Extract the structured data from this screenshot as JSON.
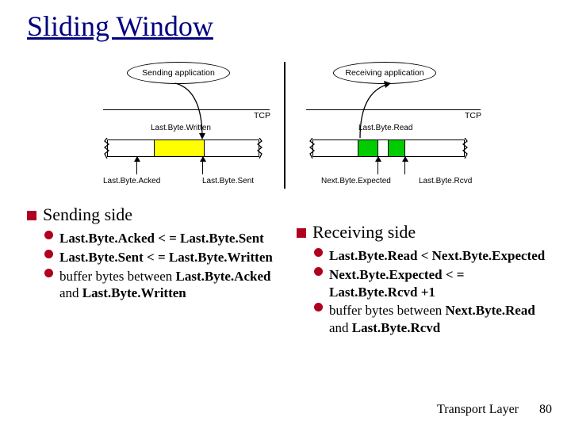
{
  "title": "Sliding Window",
  "diagram": {
    "sending_app": "Sending application",
    "receiving_app": "Receiving application",
    "tcp": "TCP",
    "last_byte_written": "Last.Byte.Written",
    "last_byte_read": "Last.Byte.Read",
    "last_byte_acked": "Last.Byte.Acked",
    "last_byte_sent": "Last.Byte.Sent",
    "next_byte_expected": "Next.Byte.Expected",
    "last_byte_rcvd": "Last.Byte.Rcvd"
  },
  "sending": {
    "heading": "Sending side",
    "b1": "Last.Byte.Acked < = Last.Byte.Sent",
    "b2": "Last.Byte.Sent < = Last.Byte.Written",
    "b3a": "buffer bytes between",
    "b3b": "Last.Byte.Acked",
    "b3c": " and ",
    "b3d": "Last.Byte.Written"
  },
  "receiving": {
    "heading": "Receiving side",
    "b1": "Last.Byte.Read < Next.Byte.Expected",
    "b2": "Next.Byte.Expected < = Last.Byte.Rcvd +1",
    "b3a": "buffer bytes between",
    "b3b": "Next.Byte.Read",
    "b3c": " and ",
    "b3d": "Last.Byte.Rcvd"
  },
  "footer": {
    "section": "Transport Layer",
    "page": "80"
  }
}
